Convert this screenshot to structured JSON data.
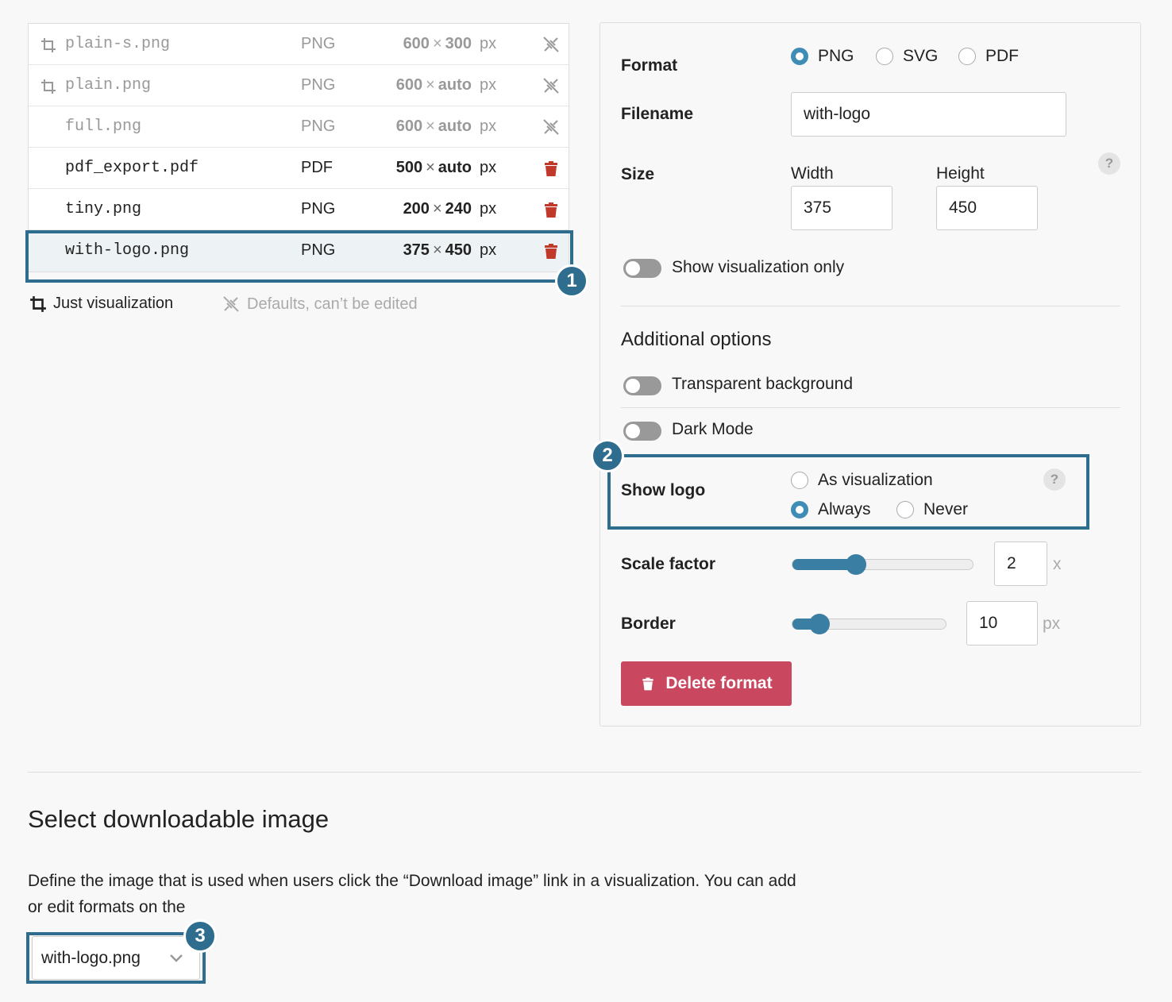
{
  "formats_table": {
    "rows": [
      {
        "name": "plain-s.png",
        "type": "PNG",
        "width": "600",
        "height": "300",
        "unit": "px",
        "icon": "crop-icon",
        "action": "not-editable-icon",
        "state": "default"
      },
      {
        "name": "plain.png",
        "type": "PNG",
        "width": "600",
        "height": "auto",
        "unit": "px",
        "icon": "crop-icon",
        "action": "not-editable-icon",
        "state": "default"
      },
      {
        "name": "full.png",
        "type": "PNG",
        "width": "600",
        "height": "auto",
        "unit": "px",
        "icon": "",
        "action": "not-editable-icon",
        "state": "default"
      },
      {
        "name": "pdf_export.pdf",
        "type": "PDF",
        "width": "500",
        "height": "auto",
        "unit": "px",
        "icon": "",
        "action": "trash-icon",
        "state": "custom"
      },
      {
        "name": "tiny.png",
        "type": "PNG",
        "width": "200",
        "height": "240",
        "unit": "px",
        "icon": "",
        "action": "trash-icon",
        "state": "custom"
      },
      {
        "name": "with-logo.png",
        "type": "PNG",
        "width": "375",
        "height": "450",
        "unit": "px",
        "icon": "",
        "action": "trash-icon",
        "state": "selected"
      }
    ],
    "times_sign": "×"
  },
  "legend": {
    "just_visualization": "Just visualization",
    "defaults_note": "Defaults, can’t be edited"
  },
  "callouts": {
    "one": "1",
    "two": "2",
    "three": "3"
  },
  "editor": {
    "format_label": "Format",
    "format_options": [
      "PNG",
      "SVG",
      "PDF"
    ],
    "format_selected": "PNG",
    "filename_label": "Filename",
    "filename_value": "with-logo",
    "size_label": "Size",
    "width_label": "Width",
    "width_value": "375",
    "height_label": "Height",
    "height_value": "450",
    "help_glyph": "?",
    "show_vis_only_label": "Show visualization only",
    "additional_options_title": "Additional options",
    "transparent_bg_label": "Transparent background",
    "dark_mode_label": "Dark Mode",
    "show_logo_label": "Show logo",
    "show_logo_options": [
      "As visualization",
      "Always",
      "Never"
    ],
    "show_logo_selected": "Always",
    "scale_factor_label": "Scale factor",
    "scale_factor_value": "2",
    "scale_factor_unit": "x",
    "border_label": "Border",
    "border_value": "10",
    "border_unit": "px",
    "delete_button_label": "Delete format"
  },
  "download_section": {
    "title": "Select downloadable image",
    "description": "Define the image that is used when users click the “Download image” link in a visualization. You can add or edit formats on the",
    "select_value": "with-logo.png"
  },
  "colors": {
    "accent": "#3f8cb7",
    "callout": "#2e6d8e",
    "delete": "#c9475f",
    "trash_icon": "#c0392b"
  }
}
